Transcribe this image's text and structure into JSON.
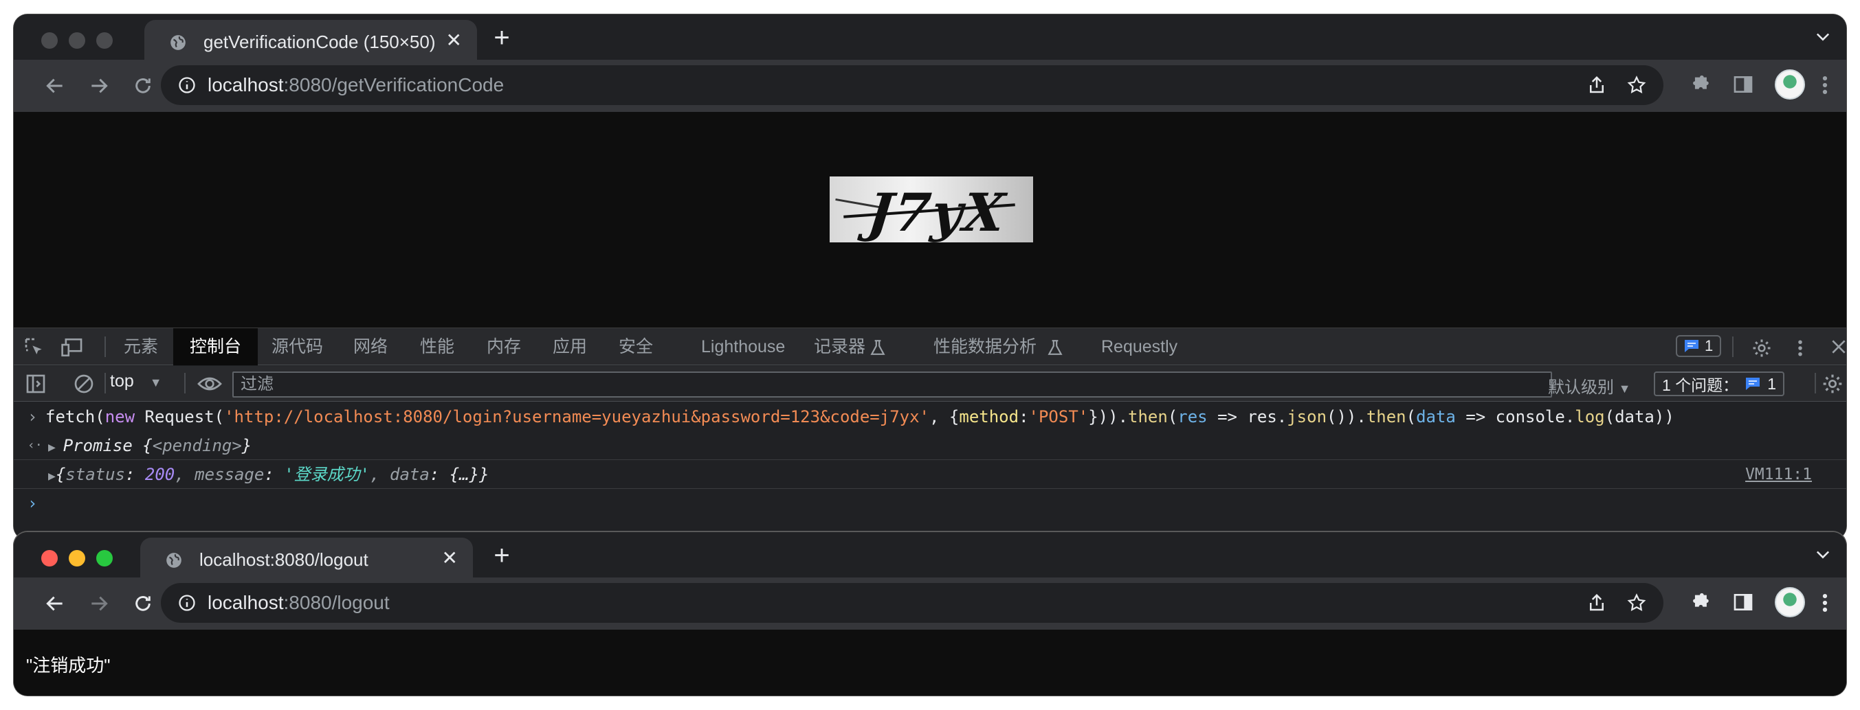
{
  "window1": {
    "tab_title": "getVerificationCode (150×50)",
    "url_host": "localhost",
    "url_path": ":8080/getVerificationCode",
    "captcha_text": "J7yX"
  },
  "devtools": {
    "tabs": [
      "元素",
      "控制台",
      "源代码",
      "网络",
      "性能",
      "内存",
      "应用",
      "安全",
      "Lighthouse",
      "记录器",
      "性能数据分析",
      "Requestly"
    ],
    "message_count": "1",
    "context": "top",
    "filter_placeholder": "过滤",
    "levels_label": "默认级别",
    "issues_label": "1 个问题：",
    "issues_count": "1",
    "console": {
      "cmd_fetch": "fetch(",
      "cmd_new": "new",
      "cmd_request": " Request(",
      "cmd_url": "'http://localhost:8080/login?username=yueyazhui&password=123&code=j7yx'",
      "cmd_opt_open": ", {",
      "cmd_method": "method",
      "cmd_colon": ":",
      "cmd_post": "'POST'",
      "cmd_close": "})).",
      "cmd_then1": "then",
      "cmd_paren1": "(",
      "cmd_res": "res",
      "cmd_arrow1": " => res.",
      "cmd_json": "json",
      "cmd_close2": "()).",
      "cmd_then2": "then",
      "cmd_paren2": "(",
      "cmd_data": "data",
      "cmd_arrow2": " => console.",
      "cmd_log": "log",
      "cmd_end": "(data))",
      "promise_word": "Promise",
      "promise_open": " {",
      "promise_pending": "<pending>",
      "promise_close": "}",
      "obj_open": "{",
      "obj_status_key": "status",
      "obj_status_sep": ": ",
      "obj_status_val": "200",
      "obj_message_key": ", message",
      "obj_message_sep": ": ",
      "obj_message_val": "'登录成功'",
      "obj_data_key": ", data",
      "obj_data_sep": ": ",
      "obj_data_val": "{…}",
      "obj_close": "}",
      "source_link": "VM111:1"
    }
  },
  "window2": {
    "tab_title": "localhost:8080/logout",
    "url_host": "localhost",
    "url_path": ":8080/logout",
    "page_text": "\"注销成功\""
  },
  "colors": {
    "close": "#ff5f57",
    "minimize": "#febc2e",
    "maximize": "#28c840",
    "inactive_light": "#4a4b4e"
  }
}
